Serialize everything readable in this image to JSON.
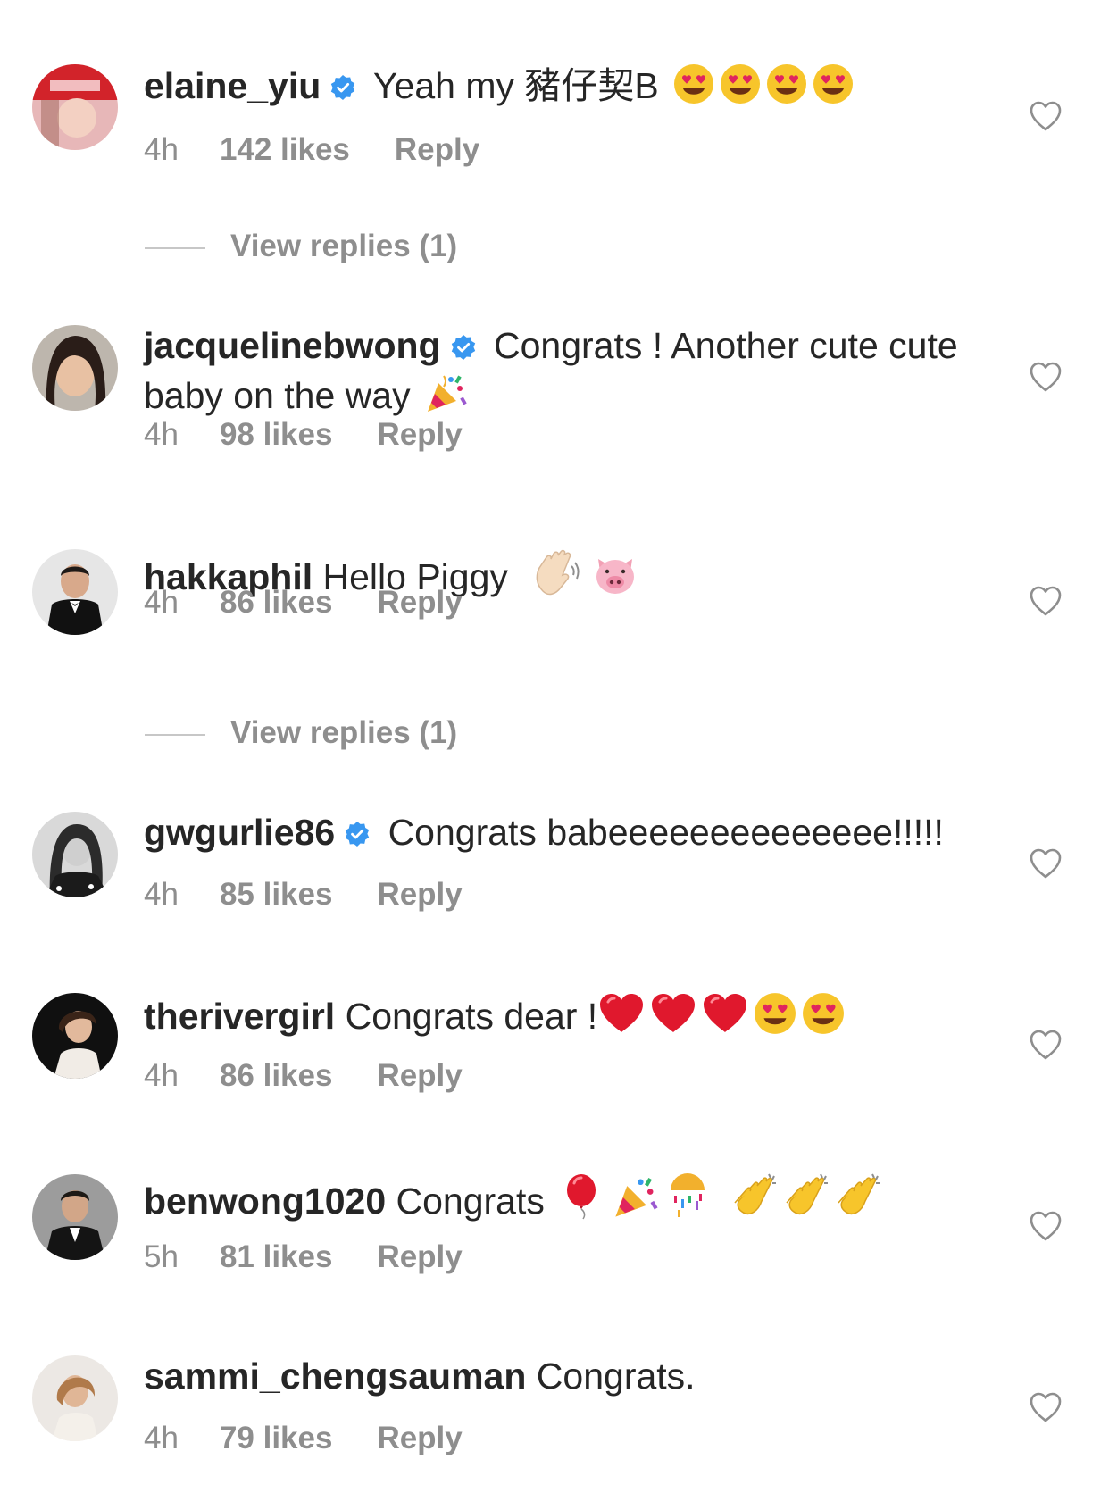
{
  "comments": [
    {
      "username": "elaine_yiu",
      "verified": true,
      "text": " Yeah my 豬仔契B",
      "emojis": [
        "heart-eyes",
        "heart-eyes",
        "heart-eyes",
        "heart-eyes"
      ],
      "time": "4h",
      "likes": "142 likes",
      "reply": "Reply",
      "view_replies": "View replies (1)"
    },
    {
      "username": "jacquelinebwong",
      "verified": true,
      "text": " Congrats ! Another cute cute baby on the way",
      "emojis": [
        "party-popper"
      ],
      "time": "4h",
      "likes": "98 likes",
      "reply": "Reply"
    },
    {
      "username": "hakkaphil",
      "verified": false,
      "text": " Hello Piggy",
      "emojis": [
        "waving-hand",
        "pig-face"
      ],
      "time": "4h",
      "likes": "86 likes",
      "reply": "Reply",
      "view_replies": "View replies (1)"
    },
    {
      "username": "gwgurlie86",
      "verified": true,
      "text": " Congrats babeeeeeeeeeeeeee!!!!!",
      "emojis": [],
      "time": "4h",
      "likes": "85 likes",
      "reply": "Reply"
    },
    {
      "username": "therivergirl",
      "verified": false,
      "text": " Congrats dear !",
      "emojis": [
        "red-heart",
        "red-heart",
        "red-heart",
        "heart-eyes",
        "heart-eyes"
      ],
      "time": "4h",
      "likes": "86 likes",
      "reply": "Reply"
    },
    {
      "username": "benwong1020",
      "verified": false,
      "text": " Congrats",
      "emojis": [
        "balloon",
        "party-popper",
        "confetti-ball",
        "clapping-hands",
        "clapping-hands",
        "clapping-hands"
      ],
      "time": "5h",
      "likes": "81 likes",
      "reply": "Reply"
    },
    {
      "username": "sammi_chengsauman",
      "verified": false,
      "text": " Congrats.",
      "emojis": [],
      "time": "4h",
      "likes": "79 likes",
      "reply": "Reply"
    }
  ],
  "colors": {
    "text": "#262626",
    "secondary": "#8e8e8e",
    "verified": "#3897f0"
  }
}
